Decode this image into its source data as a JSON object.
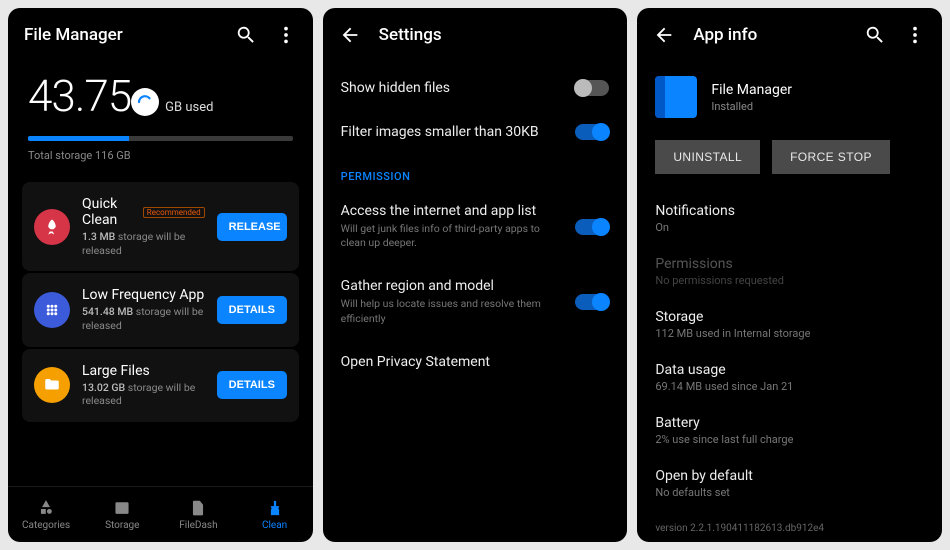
{
  "screen1": {
    "title": "File Manager",
    "storage_used_value": "43.75",
    "storage_used_unit": "GB used",
    "total_storage": "Total storage 116 GB",
    "progress_percent": 38,
    "cards": [
      {
        "title": "Quick Clean",
        "badge": "Recommended",
        "sub_value": "1.3 MB",
        "sub_text": " storage will be released",
        "button": "RELEASE",
        "icon": "rocket",
        "icon_color": "red"
      },
      {
        "title": "Low Frequency App",
        "sub_value": "541.48 MB",
        "sub_text": " storage will be released",
        "button": "DETAILS",
        "icon": "grid",
        "icon_color": "blue"
      },
      {
        "title": "Large Files",
        "sub_value": "13.02 GB",
        "sub_text": " storage will be released",
        "button": "DETAILS",
        "icon": "folder",
        "icon_color": "orange"
      }
    ],
    "nav": [
      {
        "label": "Categories"
      },
      {
        "label": "Storage"
      },
      {
        "label": "FileDash"
      },
      {
        "label": "Clean"
      }
    ]
  },
  "screen2": {
    "title": "Settings",
    "rows": [
      {
        "title": "Show hidden files",
        "toggle": "off"
      },
      {
        "title": "Filter images smaller than 30KB",
        "toggle": "on"
      }
    ],
    "section": "PERMISSION",
    "perms": [
      {
        "title": "Access the internet and app list",
        "sub": "Will get junk files info of third-party apps to clean up deeper.",
        "toggle": "on"
      },
      {
        "title": "Gather region and model",
        "sub": "Will help us locate issues and resolve them efficiently",
        "toggle": "on"
      }
    ],
    "privacy": "Open Privacy Statement"
  },
  "screen3": {
    "title": "App info",
    "app_name": "File Manager",
    "app_status": "Installed",
    "btn_uninstall": "UNINSTALL",
    "btn_forcestop": "FORCE STOP",
    "rows": [
      {
        "title": "Notifications",
        "sub": "On"
      },
      {
        "title": "Permissions",
        "sub": "No permissions requested",
        "disabled": true
      },
      {
        "title": "Storage",
        "sub": "112 MB used in Internal storage"
      },
      {
        "title": "Data usage",
        "sub": "69.14 MB used since Jan 21"
      },
      {
        "title": "Battery",
        "sub": "2% use since last full charge"
      },
      {
        "title": "Open by default",
        "sub": "No defaults set"
      }
    ],
    "version": "version 2.2.1.190411182613.db912e4"
  }
}
